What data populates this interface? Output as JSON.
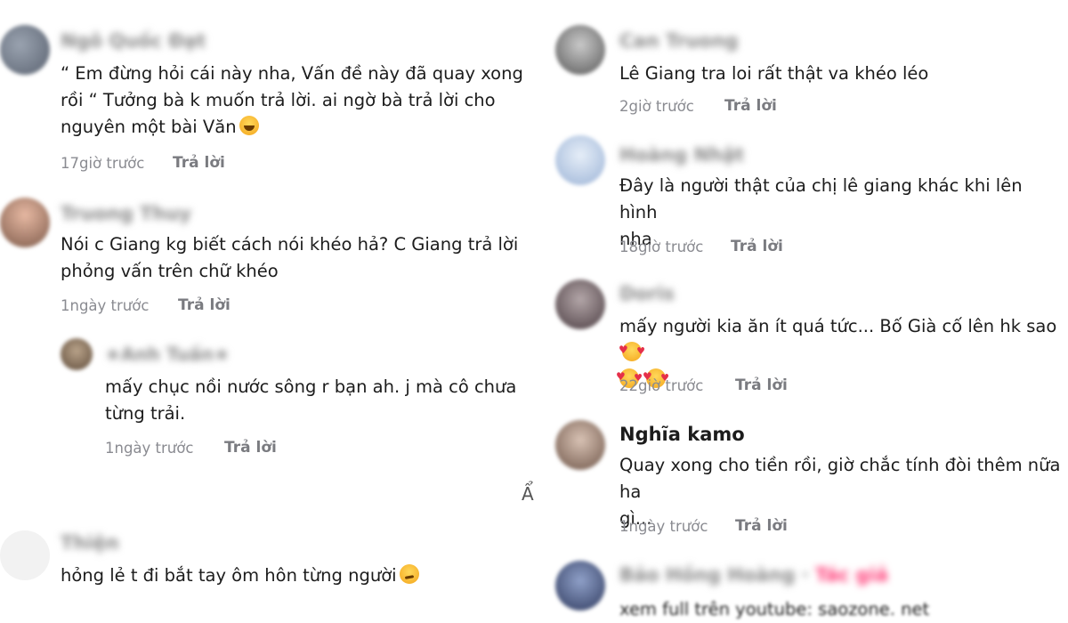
{
  "reply_label": "Trả lời",
  "left": [
    {
      "user": "Ngô Quốc Đạt",
      "text": "“ Em đừng hỏi cái này nha, Vấn đề này đã quay xong\nrồi “ Tưởng bà k muốn trả lời. ai ngờ bà trả lời cho\nnguyên một bài Văn",
      "emoji": "grinning-squinting-face",
      "time": "17giờ trước"
    },
    {
      "user": "Truong Thuy",
      "text": "Nói c Giang kg biết cách nói khéo hả? C Giang trả lời\nphỏng vấn trên chữ khéo",
      "time": "1ngày trước"
    },
    {
      "user": "★Anh Tuấn★",
      "text": "mấy chục nồi nước sông r bạn ah. j mà cô chưa\ntừng trải.",
      "time": "1ngày trước",
      "is_reply": true
    },
    {
      "user": "Thiện",
      "text": "hỏng lẻ t đi bắt tay ôm hôn từng người",
      "emoji": "smirking-face"
    }
  ],
  "left_edge_char": "Ẩ",
  "right": [
    {
      "user": "Can Truong",
      "text": "Lê Giang tra loi rất thật va khéo léo",
      "time": "2giờ trước"
    },
    {
      "user": "Hoàng Nhật",
      "text": "Đây là người thật của chị lê giang khác khi lên hình\nnha",
      "time": "18giờ trước"
    },
    {
      "user": "Doris",
      "text": "mấy người kia ăn ít quá tức... Bố Già cố lên hk sao",
      "emoji": "smiling-face-with-hearts",
      "time": "22giờ trước"
    },
    {
      "user": "Nghĩa kamo",
      "text": "Quay xong cho tiền rồi, giờ chắc tính đòi thêm nữa ha\ngì...",
      "time": "1ngày trước"
    },
    {
      "user": "Bảo Hồng Hoàng",
      "tag": "Tác giả",
      "text": "xem full trên youtube: saozone. net"
    }
  ]
}
